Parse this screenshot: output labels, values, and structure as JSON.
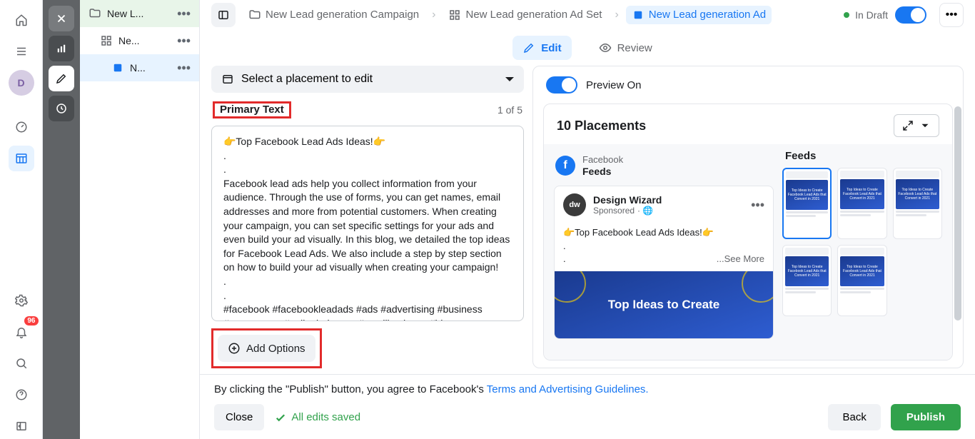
{
  "far_rail": {
    "avatar_letter": "D",
    "notif_badge": "96"
  },
  "tree": {
    "items": [
      {
        "label": "New L..."
      },
      {
        "label": "Ne..."
      },
      {
        "label": "N..."
      }
    ]
  },
  "breadcrumb": {
    "campaign": "New Lead generation Campaign",
    "adset": "New Lead generation Ad Set",
    "ad": "New Lead generation Ad"
  },
  "status": {
    "draft": "In Draft"
  },
  "subtabs": {
    "edit": "Edit",
    "review": "Review"
  },
  "placement_selector": "Select a placement to edit",
  "primary_text": {
    "label": "Primary Text",
    "counter": "1 of 5",
    "content": "👉Top Facebook Lead Ads Ideas!👉\n.\n.\nFacebook lead ads help you collect information from your audience. Through the use of forms, you can get names, email addresses and more from potential customers. When creating your campaign, you can set specific settings for your ads and even build your ad visually. In this blog, we detailed the top ideas for Facebook Lead Ads. We also include a step by step section on how to build your ad visually when creating your campaign!\n.\n.\n#facebook #facebookleadads #ads #advertising #business #ecommerce #onlinebuinsess #smallbusiness #ideas"
  },
  "add_options": "Add Options",
  "preview": {
    "toggle_label": "Preview On",
    "placements_title": "10 Placements",
    "platform": {
      "name": "Facebook",
      "sub": "Feeds"
    },
    "ad": {
      "page_name": "Design Wizard",
      "sponsored": "Sponsored",
      "text": "👉Top Facebook Lead Ads Ideas!👉\n.\n.",
      "see_more": "...See More",
      "image_title": "Top Ideas to Create"
    },
    "thumbs_title": "Feeds",
    "thumb_caption": "Top Ideas to Create Facebook Lead Ads that Convert in 2021"
  },
  "footer": {
    "legal_prefix": "By clicking the \"Publish\" button, you agree to Facebook's ",
    "legal_link": "Terms and Advertising Guidelines.",
    "close": "Close",
    "saved": "All edits saved",
    "back": "Back",
    "publish": "Publish"
  }
}
